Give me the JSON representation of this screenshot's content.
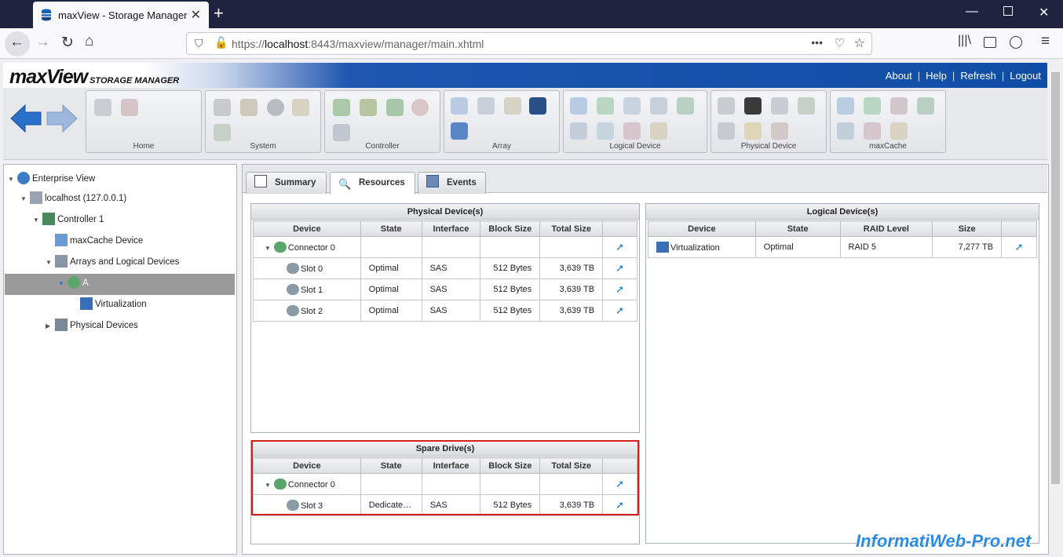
{
  "browser": {
    "tab_title": "maxView - Storage Manager",
    "url_prefix": "https://",
    "url_host": "localhost",
    "url_rest": ":8443/maxview/manager/main.xhtml"
  },
  "app": {
    "logo_main": "maxView",
    "logo_sub": "STORAGE MANAGER",
    "links": [
      "About",
      "Help",
      "Refresh",
      "Logout"
    ]
  },
  "toolbar": {
    "groups": [
      "Home",
      "System",
      "Controller",
      "Array",
      "Logical Device",
      "Physical Device",
      "maxCache"
    ]
  },
  "tree": {
    "items": [
      "Enterprise View",
      "localhost (127.0.0.1)",
      "Controller 1",
      "maxCache Device",
      "Arrays and Logical Devices",
      "A",
      "Virtualization",
      "Physical Devices"
    ]
  },
  "tabs": [
    "Summary",
    "Resources",
    "Events"
  ],
  "physical": {
    "title": "Physical Device(s)",
    "headers": [
      "Device",
      "State",
      "Interface",
      "Block Size",
      "Total Size"
    ],
    "rows": [
      {
        "device": "Connector 0",
        "state": "",
        "interface": "",
        "block": "",
        "total": ""
      },
      {
        "device": "Slot 0",
        "state": "Optimal",
        "interface": "SAS",
        "block": "512 Bytes",
        "total": "3,639 TB"
      },
      {
        "device": "Slot 1",
        "state": "Optimal",
        "interface": "SAS",
        "block": "512 Bytes",
        "total": "3,639 TB"
      },
      {
        "device": "Slot 2",
        "state": "Optimal",
        "interface": "SAS",
        "block": "512 Bytes",
        "total": "3,639 TB"
      }
    ]
  },
  "spare": {
    "title": "Spare Drive(s)",
    "headers": [
      "Device",
      "State",
      "Interface",
      "Block Size",
      "Total Size"
    ],
    "rows": [
      {
        "device": "Connector 0",
        "state": "",
        "interface": "",
        "block": "",
        "total": ""
      },
      {
        "device": "Slot 3",
        "state": "Dedicate…",
        "interface": "SAS",
        "block": "512 Bytes",
        "total": "3,639 TB"
      }
    ]
  },
  "logical": {
    "title": "Logical Device(s)",
    "headers": [
      "Device",
      "State",
      "RAID Level",
      "Size"
    ],
    "rows": [
      {
        "device": "Virtualization",
        "state": "Optimal",
        "raid": "RAID 5",
        "size": "7,277 TB"
      }
    ]
  },
  "watermark": "InformatiWeb-Pro.net",
  "colors": {
    "accent": "#0f4ea6",
    "highlight": "#d62020",
    "link_arrow": "#1a76c8"
  }
}
